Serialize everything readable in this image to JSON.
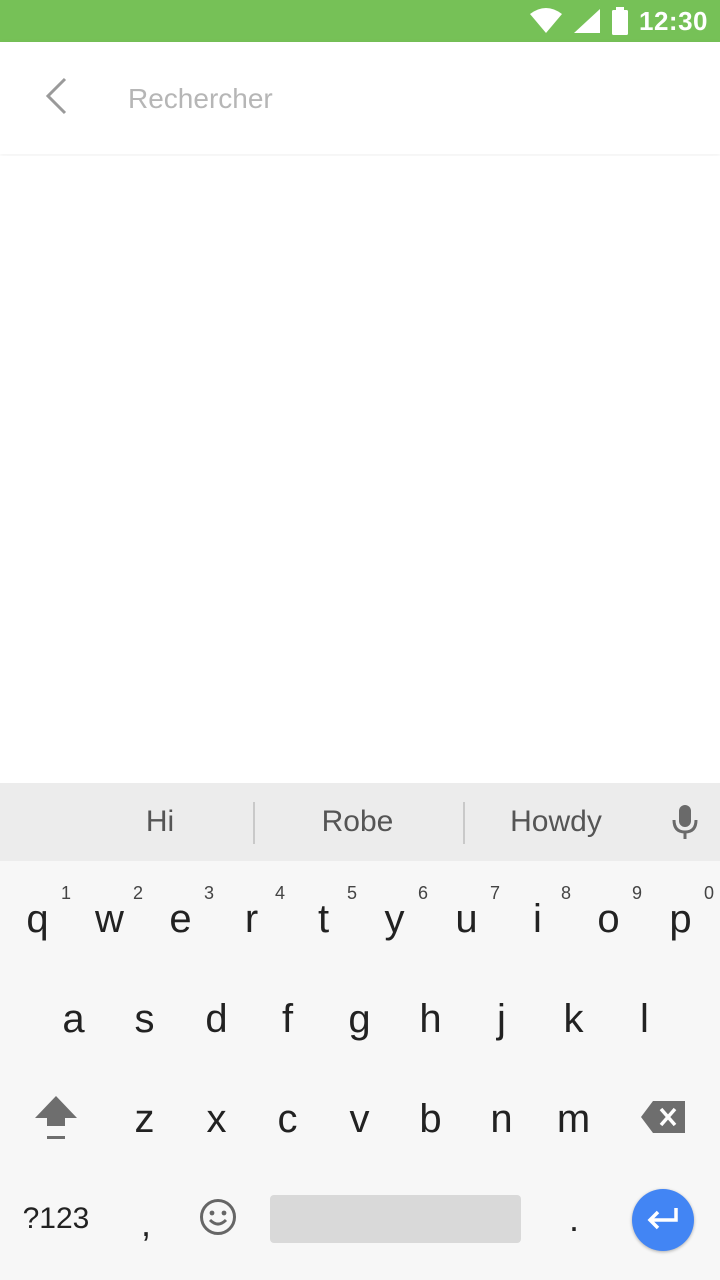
{
  "status_bar": {
    "time": "12:30",
    "background": "#76c157",
    "icons": [
      "wifi-icon",
      "cell-signal-icon",
      "battery-icon"
    ]
  },
  "search": {
    "placeholder": "Rechercher",
    "value": "",
    "back_icon": "chevron-left-icon"
  },
  "keyboard": {
    "suggestions": [
      "Hi",
      "Robe",
      "Howdy"
    ],
    "mic_icon": "microphone-icon",
    "rows": [
      {
        "keys": [
          "q",
          "w",
          "e",
          "r",
          "t",
          "y",
          "u",
          "i",
          "o",
          "p"
        ],
        "hints": [
          "1",
          "2",
          "3",
          "4",
          "5",
          "6",
          "7",
          "8",
          "9",
          "0"
        ]
      },
      {
        "keys": [
          "a",
          "s",
          "d",
          "f",
          "g",
          "h",
          "j",
          "k",
          "l"
        ]
      },
      {
        "keys": [
          "z",
          "x",
          "c",
          "v",
          "b",
          "n",
          "m"
        ]
      }
    ],
    "symbols_label": "?123",
    "comma_label": ",",
    "period_label": ".",
    "shift_icon": "shift-icon",
    "backspace_icon": "backspace-icon",
    "emoji_icon": "emoji-icon",
    "enter_icon": "enter-icon",
    "enter_color": "#4285f4"
  }
}
